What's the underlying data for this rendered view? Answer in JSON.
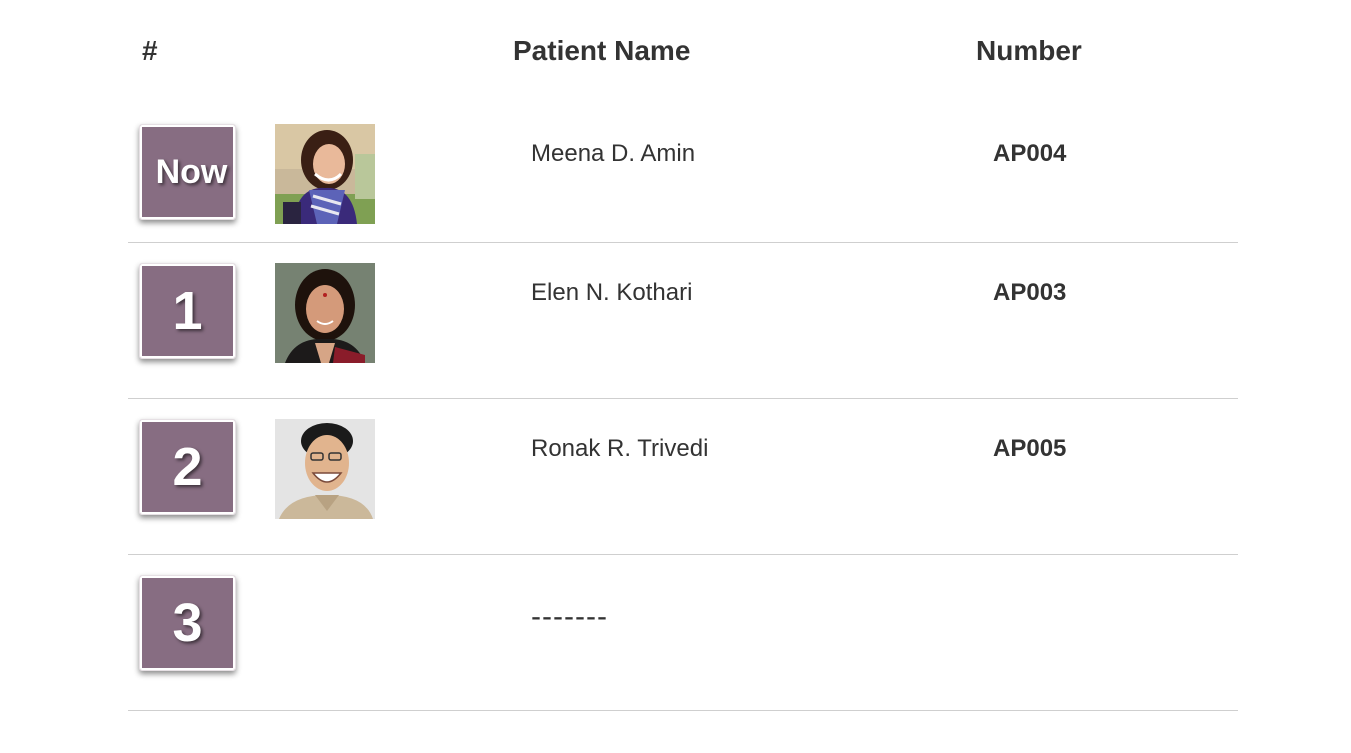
{
  "headers": {
    "index": "#",
    "patient_name": "Patient Name",
    "number": "Number"
  },
  "rows": [
    {
      "position": "Now",
      "photo_icon": "patient-photo-woman-scarf",
      "name": "Meena D. Amin",
      "number": "AP004"
    },
    {
      "position": "1",
      "photo_icon": "patient-photo-woman-saree",
      "name": "Elen N. Kothari",
      "number": "AP003"
    },
    {
      "position": "2",
      "photo_icon": "patient-photo-man-glasses",
      "name": "Ronak R. Trivedi",
      "number": "AP005"
    },
    {
      "position": "3",
      "name": "-------",
      "number": ""
    }
  ],
  "colors": {
    "badge": "#876d82",
    "text": "#333333",
    "divider": "#cfcfcf"
  }
}
